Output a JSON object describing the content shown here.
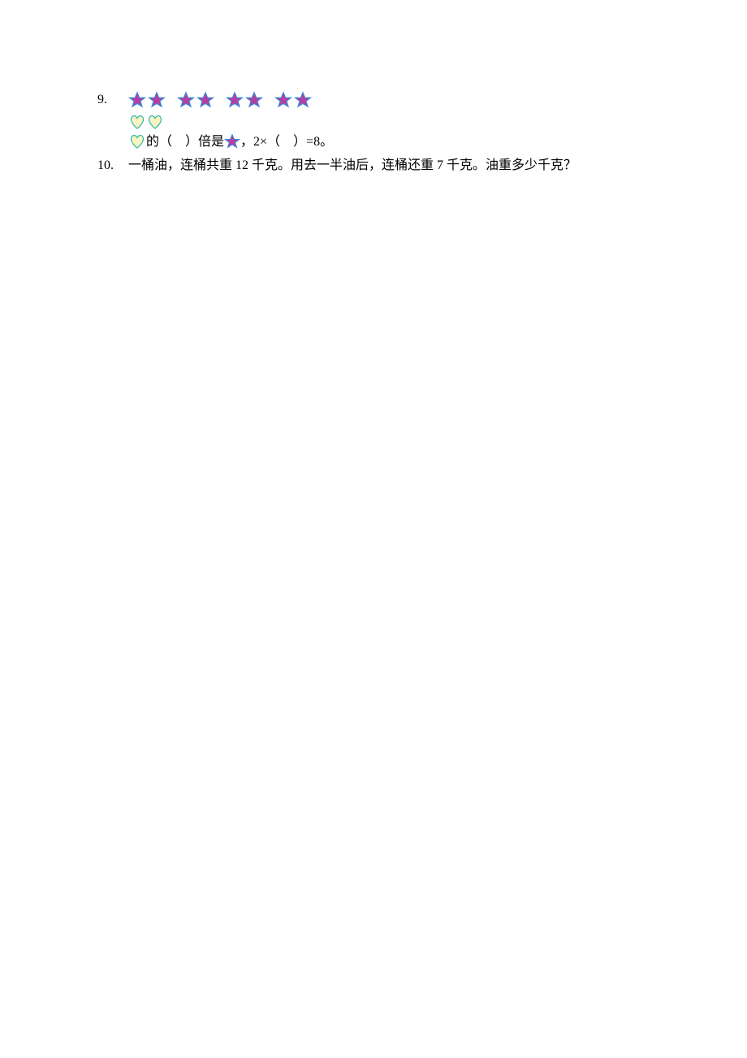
{
  "q9": {
    "number": "9. ",
    "star_groups": 4,
    "stars_per_group": 2,
    "hearts_row_count": 2,
    "fill_text": {
      "t1": "的（",
      "blank1": "    ",
      "t2": "）倍是",
      "t3": "，2×（",
      "blank2": "    ",
      "t4": "）=8。"
    }
  },
  "q10": {
    "number": "10.",
    "text": "一桶油，连桶共重 12 千克。用去一半油后，连桶还重 7 千克。油重多少千克？"
  },
  "colors": {
    "star_fill": "#b83da3",
    "star_stroke": "#2e8bd9",
    "heart_fill": "#f7f3c2",
    "heart_stroke": "#2eb8a8"
  }
}
